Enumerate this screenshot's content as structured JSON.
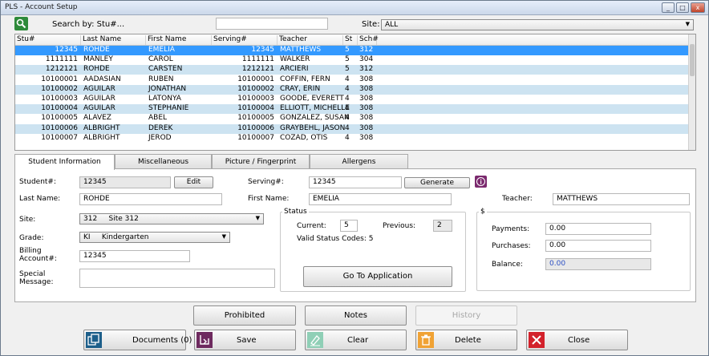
{
  "window": {
    "title": "PLS - Account Setup",
    "buttons": [
      "_",
      "□",
      "x"
    ]
  },
  "search": {
    "label": "Search by: Stu#...",
    "value": "",
    "site_label": "Site:",
    "site_value": "ALL"
  },
  "grid": {
    "columns": [
      "Stu#",
      "Last Name",
      "First Name",
      "Serving#",
      "Teacher",
      "St",
      "Sch#"
    ],
    "rows": [
      [
        "12345",
        "ROHDE",
        "EMELIA",
        "12345",
        "MATTHEWS",
        "5",
        "312"
      ],
      [
        "1111111",
        "MANLEY",
        "CAROL",
        "1111111",
        "WALKER",
        "5",
        "304"
      ],
      [
        "1212121",
        "ROHDE",
        "CARSTEN",
        "1212121",
        "ARCIERI",
        "5",
        "312"
      ],
      [
        "10100001",
        "AADASIAN",
        "RUBEN",
        "10100001",
        "COFFIN, FERN",
        "4",
        "308"
      ],
      [
        "10100002",
        "AGUILAR",
        "JONATHAN",
        "10100002",
        "CRAY, ERIN",
        "4",
        "308"
      ],
      [
        "10100003",
        "AGUILAR",
        "LATONYA",
        "10100003",
        "GOODE, EVERETT",
        "4",
        "308"
      ],
      [
        "10100004",
        "AGUILAR",
        "STEPHANIE",
        "10100004",
        "ELLIOTT, MICHELLE",
        "4",
        "308"
      ],
      [
        "10100005",
        "ALAVEZ",
        "ABEL",
        "10100005",
        "GONZALEZ, SUSAN",
        "4",
        "308"
      ],
      [
        "10100006",
        "ALBRIGHT",
        "DEREK",
        "10100006",
        "GRAYBEHL, JASON",
        "4",
        "308"
      ],
      [
        "10100007",
        "ALBRIGHT",
        "JEROD",
        "10100007",
        "COZAD, OTIS",
        "4",
        "308"
      ]
    ]
  },
  "tabs": [
    "Student Information",
    "Miscellaneous",
    "Picture / Fingerprint",
    "Allergens"
  ],
  "student": {
    "student_label": "Student#:",
    "student_value": "12345",
    "edit_label": "Edit",
    "last_label": "Last Name:",
    "last_value": "ROHDE",
    "site_label": "Site:",
    "site_value": "312     Site 312",
    "grade_label": "Grade:",
    "grade_value": "KI     Kindergarten",
    "billing_label": "Billing\nAccount#:",
    "billing_value": "12345",
    "special_label": "Special\nMessage:",
    "special_value": "",
    "serving_label": "Serving#:",
    "serving_value": "12345",
    "generate_label": "Generate",
    "first_label": "First Name:",
    "first_value": "EMELIA",
    "teacher_label": "Teacher:",
    "teacher_value": "MATTHEWS"
  },
  "status": {
    "title": "Status",
    "current_label": "Current:",
    "current_value": "5",
    "previous_label": "Previous:",
    "previous_value": "2",
    "valid_codes": "Valid Status Codes: 5",
    "go_label": "Go To Application"
  },
  "money": {
    "title": "$",
    "payments_label": "Payments:",
    "payments_value": "0.00",
    "purchases_label": "Purchases:",
    "purchases_value": "0.00",
    "balance_label": "Balance:",
    "balance_value": "0.00"
  },
  "actions": {
    "prohibited": "Prohibited",
    "notes": "Notes",
    "history": "History",
    "documents": "Documents (0)",
    "save": "Save",
    "clear": "Clear",
    "delete": "Delete",
    "close": "Close"
  },
  "colors": {
    "selected_row": "#3399ff",
    "alt_row": "#cde3f1",
    "balance_text": "#2b4fc4",
    "info_icon": "#7b2a6e"
  }
}
